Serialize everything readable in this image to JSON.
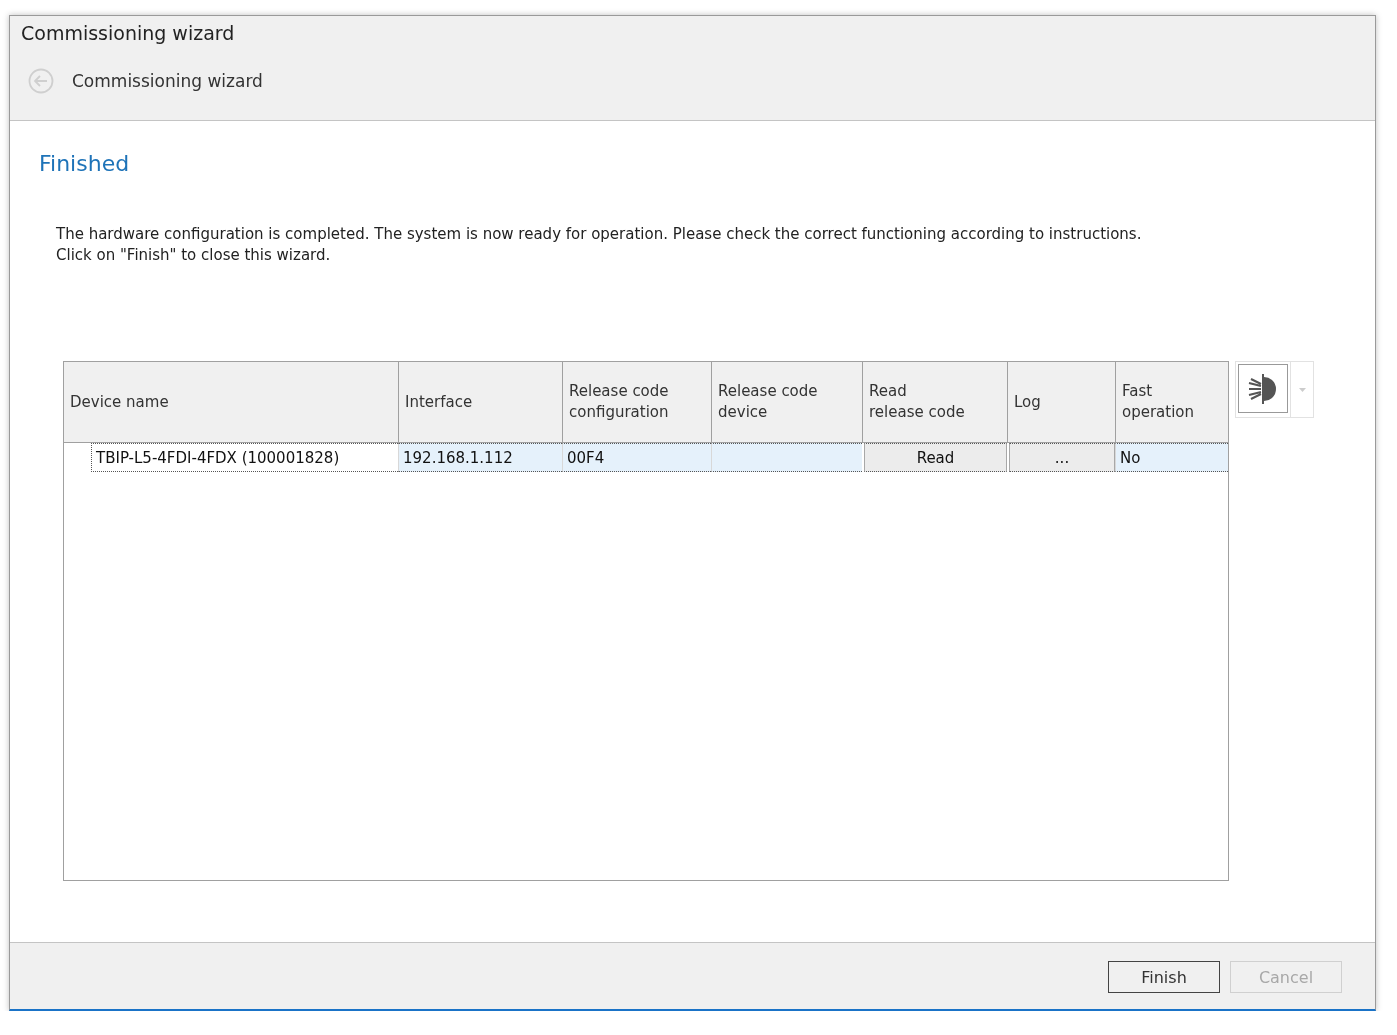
{
  "window": {
    "title": "Commissioning wizard"
  },
  "nav": {
    "back_disabled": true,
    "title": "Commissioning wizard"
  },
  "page": {
    "heading": "Finished",
    "lines": [
      "The hardware configuration is completed. The system is now ready for operation. Please check the correct functioning according to instructions.",
      "Click on \"Finish\" to close this wizard."
    ]
  },
  "table": {
    "columns": [
      "Device name",
      "Interface",
      "Release code\nconfiguration",
      "Release code\ndevice",
      "Read\nrelease code",
      "Log",
      "Fast\noperation"
    ],
    "rows": [
      {
        "selected": true,
        "cells": [
          {
            "kind": "text",
            "text": "TBIP-L5-4FDI-4FDX (100001828)"
          },
          {
            "kind": "text",
            "text": "192.168.1.112"
          },
          {
            "kind": "text",
            "text": "00F4"
          },
          {
            "kind": "empty"
          },
          {
            "kind": "button",
            "text": "Read"
          },
          {
            "kind": "button",
            "text": "..."
          },
          {
            "kind": "text",
            "text": "No"
          }
        ]
      }
    ]
  },
  "buttons": [
    {
      "label": "Finish",
      "disabled": false
    },
    {
      "label": "Cancel",
      "disabled": true
    }
  ]
}
